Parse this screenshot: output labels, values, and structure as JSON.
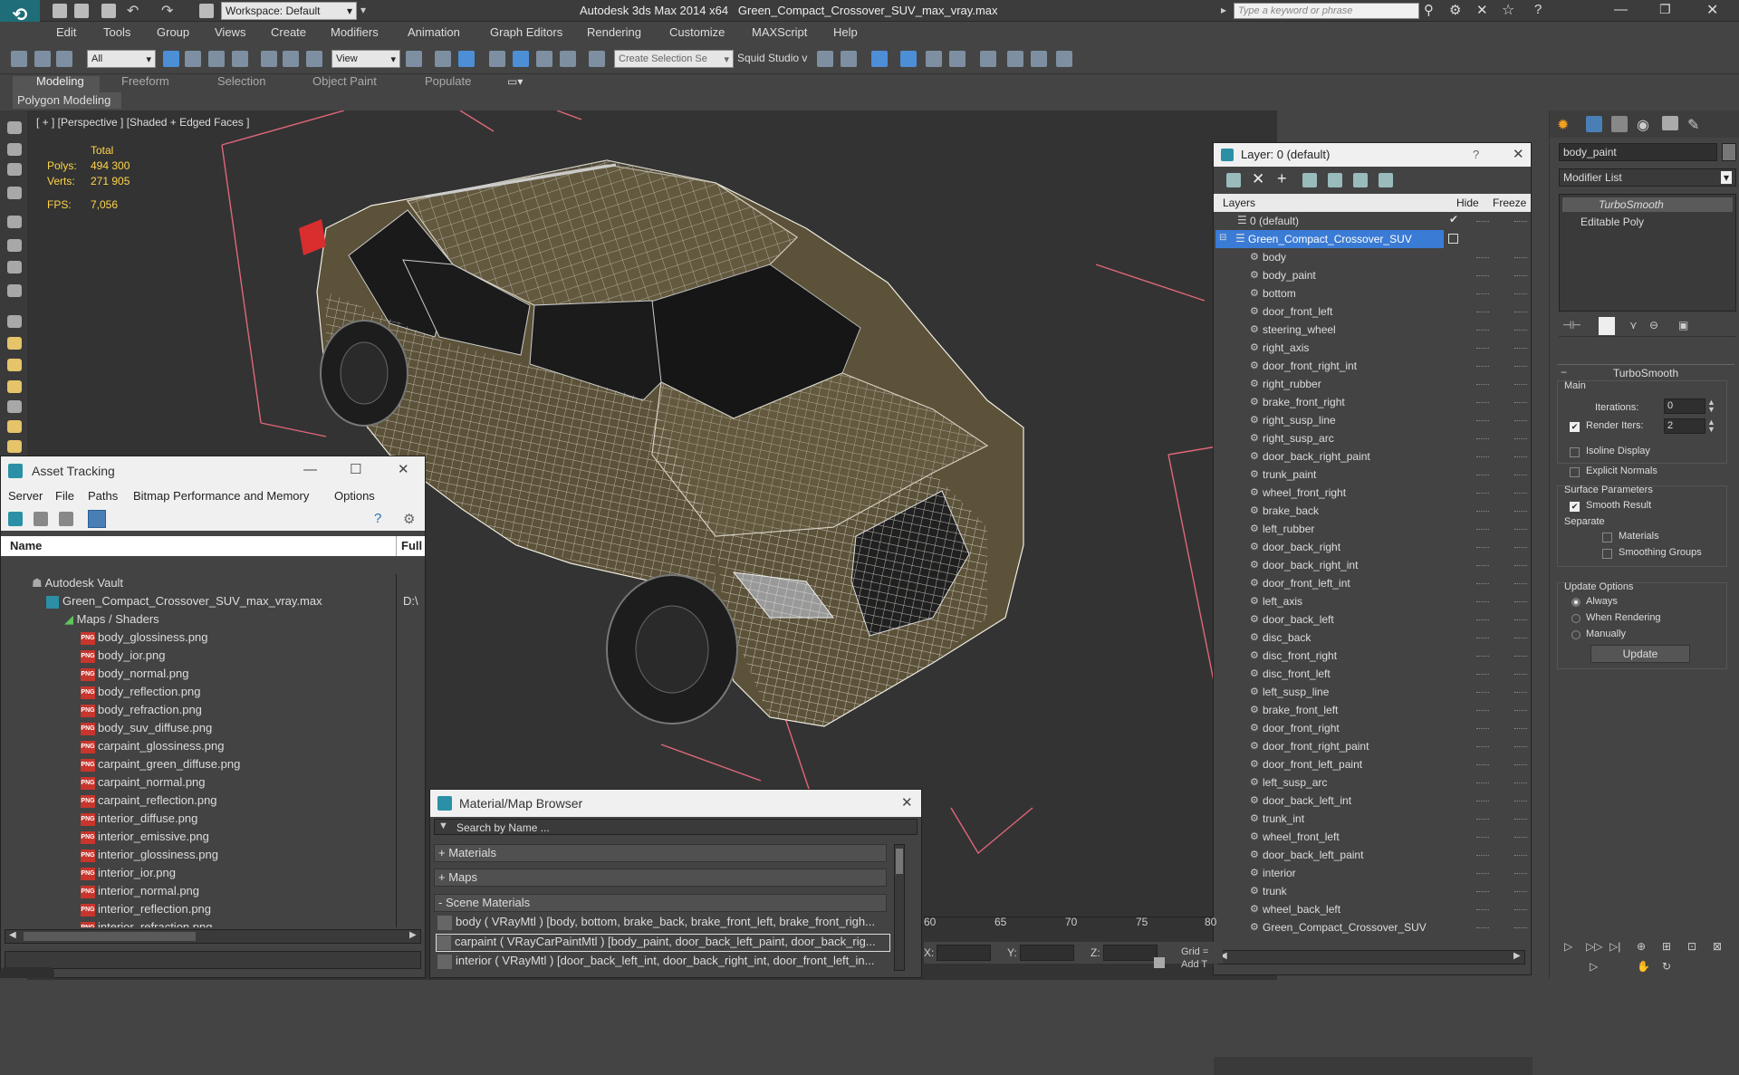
{
  "titlebar": {
    "workspace_label": "Workspace: Default",
    "app_title": "Autodesk 3ds Max  2014 x64",
    "file_title": "Green_Compact_Crossover_SUV_max_vray.max",
    "search_placeholder": "Type a keyword or phrase"
  },
  "menu": [
    "Edit",
    "Tools",
    "Group",
    "Views",
    "Create",
    "Modifiers",
    "Animation",
    "Graph Editors",
    "Rendering",
    "Customize",
    "MAXScript",
    "Help"
  ],
  "toolbar": {
    "filter_value": "All",
    "refcoord_value": "View",
    "selection_set_placeholder": "Create Selection Se",
    "squid_label": "Squid Studio v"
  },
  "ribbon": {
    "tabs": [
      "Modeling",
      "Freeform",
      "Selection",
      "Object Paint",
      "Populate"
    ],
    "sub_label": "Polygon Modeling"
  },
  "viewport": {
    "label": "[ + ] [Perspective ] [Shaded + Edged Faces ]",
    "stats_total": "Total",
    "polys_label": "Polys:",
    "polys_value": "494 300",
    "verts_label": "Verts:",
    "verts_value": "271 905",
    "fps_label": "FPS:",
    "fps_value": "7,056"
  },
  "layer_panel": {
    "title": "Layer: 0 (default)",
    "help": "?",
    "col_layers": "Layers",
    "col_hide": "Hide",
    "col_freeze": "Freeze",
    "default_layer": "0 (default)",
    "selected_layer": "Green_Compact_Crossover_SUV",
    "objects": [
      "body",
      "body_paint",
      "bottom",
      "door_front_left",
      "steering_wheel",
      "right_axis",
      "door_front_right_int",
      "right_rubber",
      "brake_front_right",
      "right_susp_line",
      "right_susp_arc",
      "door_back_right_paint",
      "trunk_paint",
      "wheel_front_right",
      "brake_back",
      "left_rubber",
      "door_back_right",
      "door_back_right_int",
      "door_front_left_int",
      "left_axis",
      "door_back_left",
      "disc_back",
      "disc_front_right",
      "disc_front_left",
      "left_susp_line",
      "brake_front_left",
      "door_front_right",
      "door_front_right_paint",
      "door_front_left_paint",
      "left_susp_arc",
      "door_back_left_int",
      "trunk_int",
      "wheel_front_left",
      "door_back_left_paint",
      "interior",
      "trunk",
      "wheel_back_left",
      "Green_Compact_Crossover_SUV"
    ]
  },
  "command_panel": {
    "object_name": "body_paint",
    "modifier_list": "Modifier List",
    "stack": [
      "TurboSmooth",
      "Editable Poly"
    ],
    "rollout_title": "TurboSmooth",
    "main_label": "Main",
    "iterations_label": "Iterations:",
    "iterations_value": "0",
    "render_iters_label": "Render Iters:",
    "render_iters_value": "2",
    "isoline": "Isoline Display",
    "explicit_normals": "Explicit Normals",
    "surface_params": "Surface Parameters",
    "smooth_result": "Smooth Result",
    "separate": "Separate",
    "materials": "Materials",
    "smoothing_groups": "Smoothing Groups",
    "update_options": "Update Options",
    "always": "Always",
    "when_rendering": "When Rendering",
    "manually": "Manually",
    "update_button": "Update"
  },
  "asset_tracking": {
    "title": "Asset Tracking",
    "menu": [
      "Server",
      "File",
      "Paths",
      "Bitmap Performance and Memory",
      "Options"
    ],
    "col_name": "Name",
    "col_full": "Full",
    "vault": "Autodesk Vault",
    "file": "Green_Compact_Crossover_SUV_max_vray.max",
    "file_path": "D:\\",
    "maps_folder": "Maps / Shaders",
    "maps": [
      "body_glossiness.png",
      "body_ior.png",
      "body_normal.png",
      "body_reflection.png",
      "body_refraction.png",
      "body_suv_diffuse.png",
      "carpaint_glossiness.png",
      "carpaint_green_diffuse.png",
      "carpaint_normal.png",
      "carpaint_reflection.png",
      "interior_diffuse.png",
      "interior_emissive.png",
      "interior_glossiness.png",
      "interior_ior.png",
      "interior_normal.png",
      "interior_reflection.png",
      "interior_refraction.png"
    ]
  },
  "material_browser": {
    "title": "Material/Map Browser",
    "search_placeholder": "Search by Name ...",
    "sections": [
      "+ Materials",
      "+ Maps",
      "- Scene Materials"
    ],
    "scene_materials": [
      "body ( VRayMtl ) [body, bottom, brake_back, brake_front_left, brake_front_righ...",
      "carpaint ( VRayCarPaintMtl ) [body_paint, door_back_left_paint, door_back_rig...",
      "interior ( VRayMtl ) [door_back_left_int, door_back_right_int, door_front_left_in..."
    ]
  },
  "timeline": {
    "ticks": [
      "60",
      "65",
      "70",
      "75",
      "80"
    ],
    "x_label": "X:",
    "y_label": "Y:",
    "z_label": "Z:",
    "grid_label": "Grid =",
    "add_label": "Add T"
  },
  "colors": {
    "accent": "#1f6d78",
    "selection": "#3a7bd5",
    "stats": "#ffd54a",
    "car": "#5b5239",
    "wire": "#ffffff",
    "helper": "#e0677a"
  }
}
